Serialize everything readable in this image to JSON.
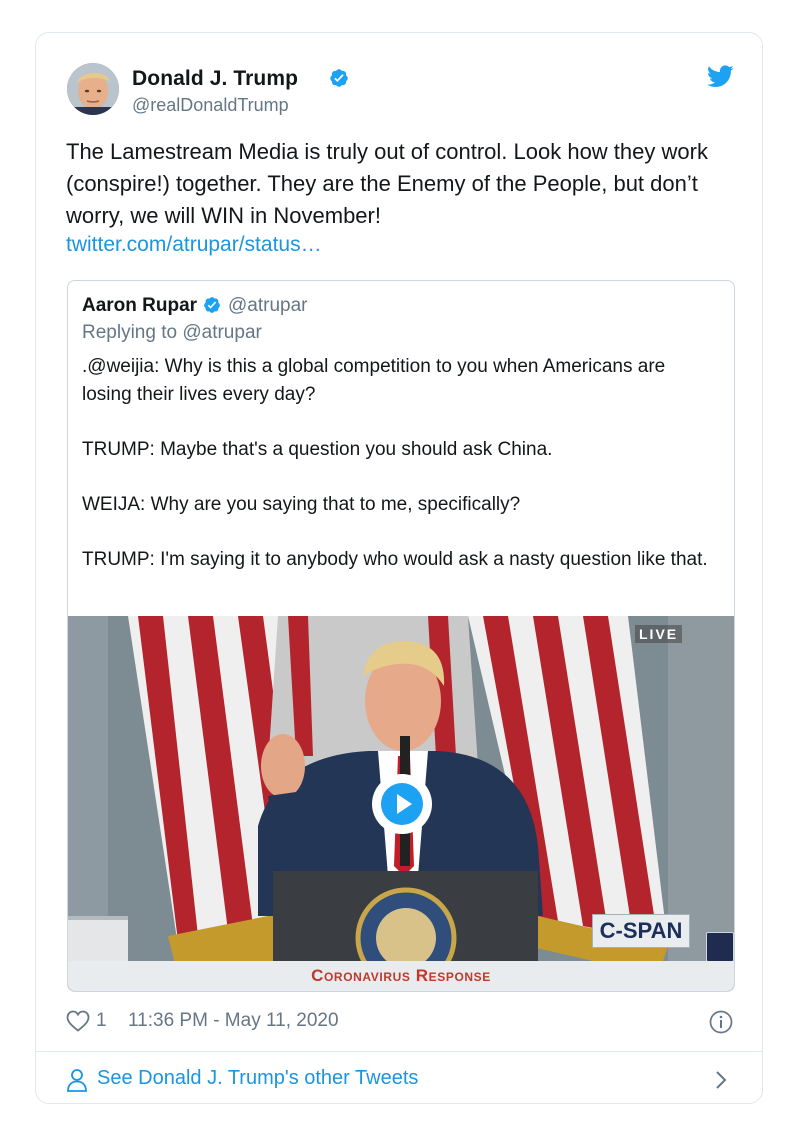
{
  "author": {
    "name": "Donald J. Trump",
    "handle": "@realDonaldTrump"
  },
  "tweet": {
    "text": "The Lamestream Media is truly out of control. Look how they work (conspire!) together. They are the Enemy of the People, but don’t worry, we will WIN in November!",
    "link": "twitter.com/atrupar/status…"
  },
  "quote": {
    "name": "Aaron Rupar",
    "handle": "@atrupar",
    "replying_prefix": "Replying to",
    "replying_handle": "@atrupar",
    "paragraphs": [
      ".@weijia: Why is this a global competition to you when Americans are losing their lives every day?",
      "TRUMP: Maybe that's a question you should ask China.",
      "WEIJA: Why are you saying that to me, specifically?",
      "TRUMP: I'm saying it to anybody who would ask a nasty question like that."
    ]
  },
  "video": {
    "live_label": "LIVE",
    "network_logo": "C-SPAN",
    "banner": "Coronavirus Response"
  },
  "meta": {
    "likes": "1",
    "timestamp": "11:36 PM - May 11, 2020"
  },
  "footer": {
    "see_other": "See Donald J. Trump's other Tweets"
  },
  "icons": {
    "verified": "verified-badge-icon",
    "bird": "twitter-bird-icon",
    "heart": "heart-icon",
    "info": "info-icon",
    "person": "person-icon",
    "chevron": "chevron-right-icon",
    "play": "play-icon"
  },
  "colors": {
    "link": "#1b95e0",
    "verified": "#1da1f2",
    "secondary_text": "#657786",
    "banner_text": "#c0392b"
  }
}
